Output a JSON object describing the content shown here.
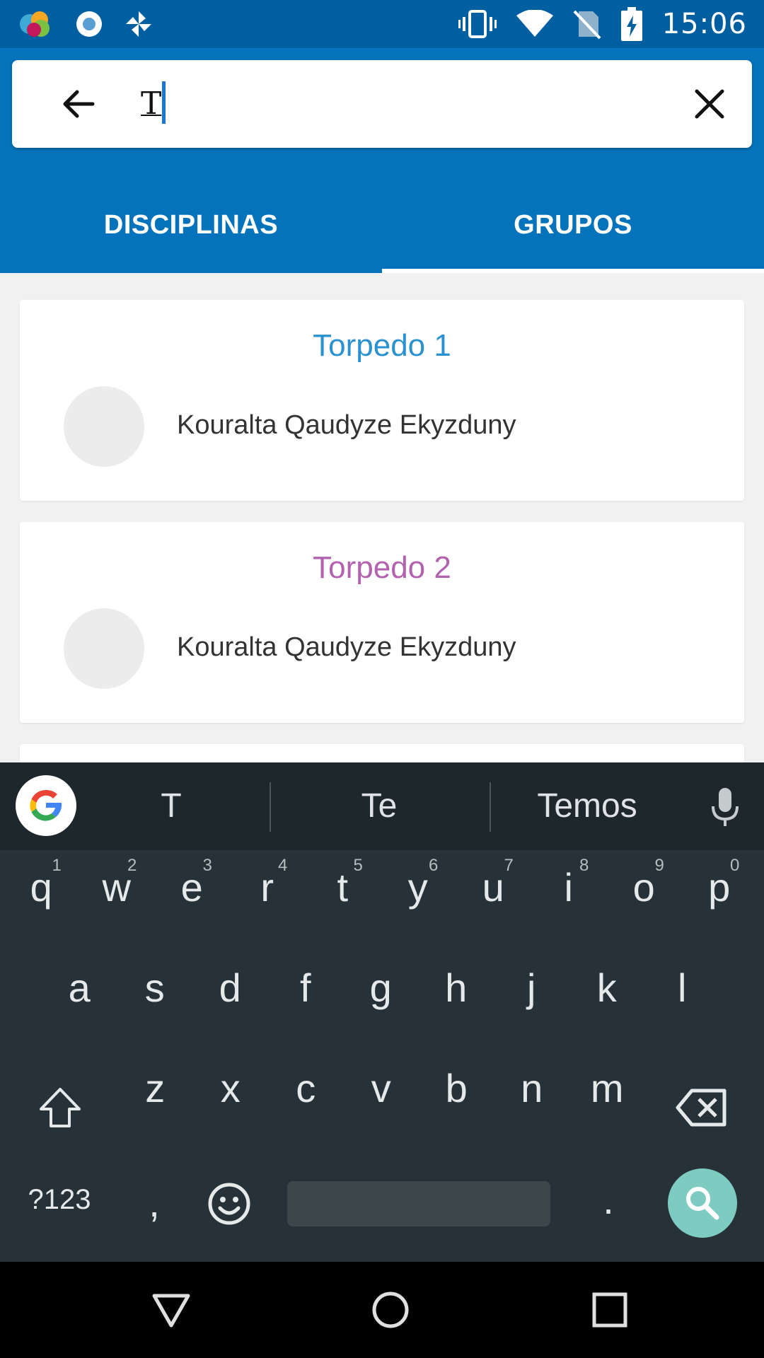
{
  "status_bar": {
    "time": "15:06",
    "left_icons": [
      "app-logo-icon",
      "record-icon",
      "pinwheel-icon"
    ],
    "right_icons": [
      "vibrate-icon",
      "wifi-icon",
      "no-sim-icon",
      "battery-charging-icon"
    ]
  },
  "search": {
    "value": "T",
    "back_icon": "arrow-left-icon",
    "clear_icon": "close-icon"
  },
  "tabs": [
    {
      "label": "DISCIPLINAS",
      "selected": false
    },
    {
      "label": "GRUPOS",
      "selected": true
    }
  ],
  "results": [
    {
      "title": "Torpedo 1",
      "title_color": "#2a92d0",
      "member": "Kouralta Qaudyze Ekyzduny"
    },
    {
      "title": "Torpedo 2",
      "title_color": "#b262ae",
      "member": "Kouralta Qaudyze Ekyzduny"
    }
  ],
  "keyboard": {
    "suggestions": [
      "T",
      "Te",
      "Temos"
    ],
    "row1": [
      "q",
      "w",
      "e",
      "r",
      "t",
      "y",
      "u",
      "i",
      "o",
      "p"
    ],
    "row1_hints": [
      "1",
      "2",
      "3",
      "4",
      "5",
      "6",
      "7",
      "8",
      "9",
      "0"
    ],
    "row2": [
      "a",
      "s",
      "d",
      "f",
      "g",
      "h",
      "j",
      "k",
      "l"
    ],
    "row3": [
      "z",
      "x",
      "c",
      "v",
      "b",
      "n",
      "m"
    ],
    "symbols_key": "?123",
    "comma_key": ",",
    "period_key": ".",
    "action_color": "#7ecbc1"
  },
  "colors": {
    "status_bar": "#005fa0",
    "app_bar": "#0473bb",
    "keyboard": "#263238"
  }
}
